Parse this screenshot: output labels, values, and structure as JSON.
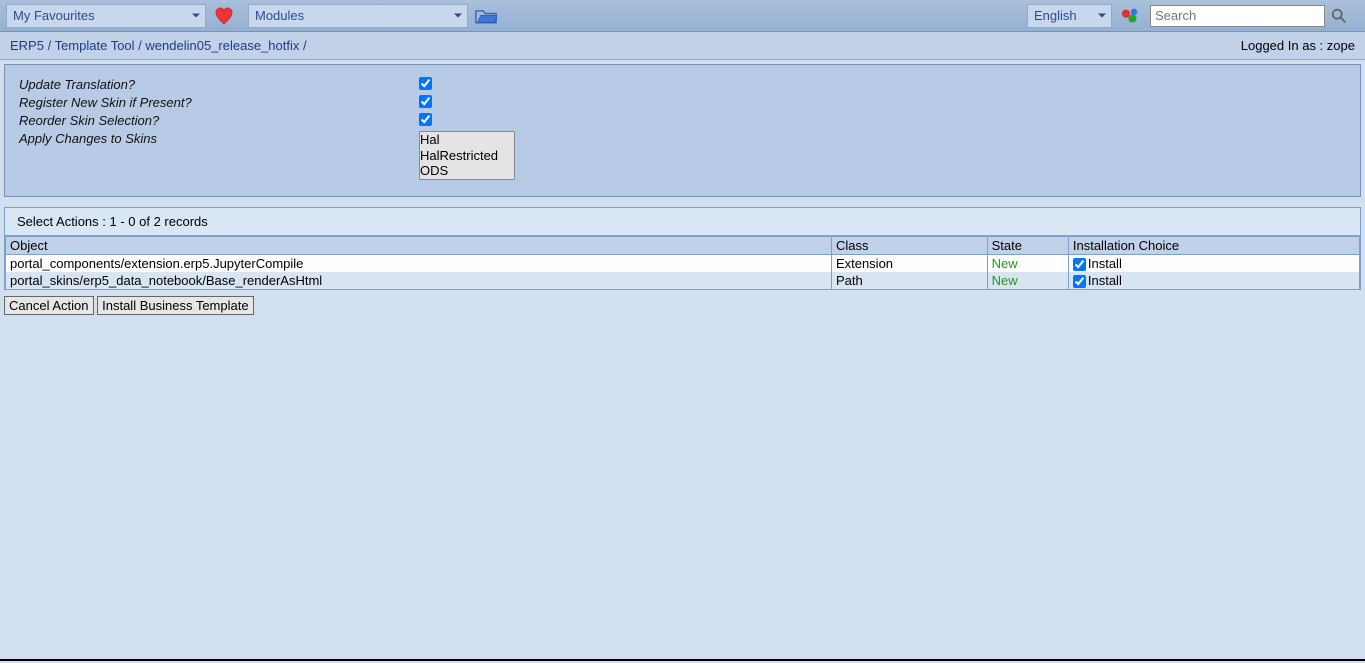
{
  "topbar": {
    "favourites_label": "My Favourites",
    "modules_label": "Modules",
    "language_label": "English",
    "search_placeholder": "Search"
  },
  "breadcrumb": {
    "parts": [
      "ERP5",
      "Template Tool",
      "wendelin05_release_hotfix"
    ],
    "login_prefix": "Logged In as :",
    "login_user": "zope"
  },
  "form": {
    "update_translation_label": "Update Translation?",
    "register_skin_label": "Register New Skin if Present?",
    "reorder_skin_label": "Reorder Skin Selection?",
    "apply_changes_label": "Apply Changes to Skins",
    "skin_options": [
      "Hal",
      "HalRestricted",
      "ODS"
    ]
  },
  "actions": {
    "header": "Select Actions :  1 - 0 of 2 records",
    "columns": {
      "object": "Object",
      "class": "Class",
      "state": "State",
      "choice": "Installation Choice"
    },
    "rows": [
      {
        "object": "portal_components/extension.erp5.JupyterCompile",
        "class": "Extension",
        "state": "New",
        "choice": "Install"
      },
      {
        "object": "portal_skins/erp5_data_notebook/Base_renderAsHtml",
        "class": "Path",
        "state": "New",
        "choice": "Install"
      }
    ]
  },
  "buttons": {
    "cancel": "Cancel Action",
    "install": "Install Business Template"
  }
}
